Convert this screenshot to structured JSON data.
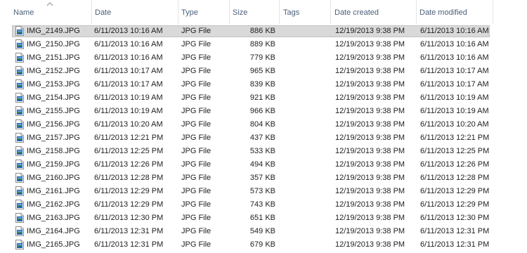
{
  "columns": [
    {
      "key": "name",
      "label": "Name"
    },
    {
      "key": "date",
      "label": "Date"
    },
    {
      "key": "type",
      "label": "Type"
    },
    {
      "key": "size",
      "label": "Size"
    },
    {
      "key": "tags",
      "label": "Tags"
    },
    {
      "key": "date_created",
      "label": "Date created"
    },
    {
      "key": "date_modified",
      "label": "Date modified"
    }
  ],
  "sort": {
    "column": "name",
    "direction": "ascending",
    "icon": "sort-ascending-icon"
  },
  "colors": {
    "header_text": "#4c607a",
    "selected_row": "#d9d9d9",
    "selected_border": "#c2c2c2",
    "file_icon_blue": "#1f63b5"
  },
  "files": [
    {
      "name": "IMG_2149.JPG",
      "date": "6/11/2013 10:16 AM",
      "type": "JPG File",
      "size": "886 KB",
      "tags": "",
      "date_created": "12/19/2013 9:38 PM",
      "date_modified": "6/11/2013 10:16 AM",
      "selected": true
    },
    {
      "name": "IMG_2150.JPG",
      "date": "6/11/2013 10:16 AM",
      "type": "JPG File",
      "size": "889 KB",
      "tags": "",
      "date_created": "12/19/2013 9:38 PM",
      "date_modified": "6/11/2013 10:16 AM"
    },
    {
      "name": "IMG_2151.JPG",
      "date": "6/11/2013 10:16 AM",
      "type": "JPG File",
      "size": "779 KB",
      "tags": "",
      "date_created": "12/19/2013 9:38 PM",
      "date_modified": "6/11/2013 10:16 AM"
    },
    {
      "name": "IMG_2152.JPG",
      "date": "6/11/2013 10:17 AM",
      "type": "JPG File",
      "size": "965 KB",
      "tags": "",
      "date_created": "12/19/2013 9:38 PM",
      "date_modified": "6/11/2013 10:17 AM"
    },
    {
      "name": "IMG_2153.JPG",
      "date": "6/11/2013 10:17 AM",
      "type": "JPG File",
      "size": "839 KB",
      "tags": "",
      "date_created": "12/19/2013 9:38 PM",
      "date_modified": "6/11/2013 10:17 AM"
    },
    {
      "name": "IMG_2154.JPG",
      "date": "6/11/2013 10:19 AM",
      "type": "JPG File",
      "size": "921 KB",
      "tags": "",
      "date_created": "12/19/2013 9:38 PM",
      "date_modified": "6/11/2013 10:19 AM"
    },
    {
      "name": "IMG_2155.JPG",
      "date": "6/11/2013 10:19 AM",
      "type": "JPG File",
      "size": "966 KB",
      "tags": "",
      "date_created": "12/19/2013 9:38 PM",
      "date_modified": "6/11/2013 10:19 AM"
    },
    {
      "name": "IMG_2156.JPG",
      "date": "6/11/2013 10:20 AM",
      "type": "JPG File",
      "size": "804 KB",
      "tags": "",
      "date_created": "12/19/2013 9:38 PM",
      "date_modified": "6/11/2013 10:20 AM"
    },
    {
      "name": "IMG_2157.JPG",
      "date": "6/11/2013 12:21 PM",
      "type": "JPG File",
      "size": "437 KB",
      "tags": "",
      "date_created": "12/19/2013 9:38 PM",
      "date_modified": "6/11/2013 12:21 PM"
    },
    {
      "name": "IMG_2158.JPG",
      "date": "6/11/2013 12:25 PM",
      "type": "JPG File",
      "size": "533 KB",
      "tags": "",
      "date_created": "12/19/2013 9:38 PM",
      "date_modified": "6/11/2013 12:25 PM"
    },
    {
      "name": "IMG_2159.JPG",
      "date": "6/11/2013 12:26 PM",
      "type": "JPG File",
      "size": "494 KB",
      "tags": "",
      "date_created": "12/19/2013 9:38 PM",
      "date_modified": "6/11/2013 12:26 PM"
    },
    {
      "name": "IMG_2160.JPG",
      "date": "6/11/2013 12:28 PM",
      "type": "JPG File",
      "size": "357 KB",
      "tags": "",
      "date_created": "12/19/2013 9:38 PM",
      "date_modified": "6/11/2013 12:28 PM"
    },
    {
      "name": "IMG_2161.JPG",
      "date": "6/11/2013 12:29 PM",
      "type": "JPG File",
      "size": "573 KB",
      "tags": "",
      "date_created": "12/19/2013 9:38 PM",
      "date_modified": "6/11/2013 12:29 PM"
    },
    {
      "name": "IMG_2162.JPG",
      "date": "6/11/2013 12:29 PM",
      "type": "JPG File",
      "size": "743 KB",
      "tags": "",
      "date_created": "12/19/2013 9:38 PM",
      "date_modified": "6/11/2013 12:29 PM"
    },
    {
      "name": "IMG_2163.JPG",
      "date": "6/11/2013 12:30 PM",
      "type": "JPG File",
      "size": "651 KB",
      "tags": "",
      "date_created": "12/19/2013 9:38 PM",
      "date_modified": "6/11/2013 12:30 PM"
    },
    {
      "name": "IMG_2164.JPG",
      "date": "6/11/2013 12:31 PM",
      "type": "JPG File",
      "size": "549 KB",
      "tags": "",
      "date_created": "12/19/2013 9:38 PM",
      "date_modified": "6/11/2013 12:31 PM"
    },
    {
      "name": "IMG_2165.JPG",
      "date": "6/11/2013 12:31 PM",
      "type": "JPG File",
      "size": "679 KB",
      "tags": "",
      "date_created": "12/19/2013 9:38 PM",
      "date_modified": "6/11/2013 12:31 PM"
    }
  ]
}
